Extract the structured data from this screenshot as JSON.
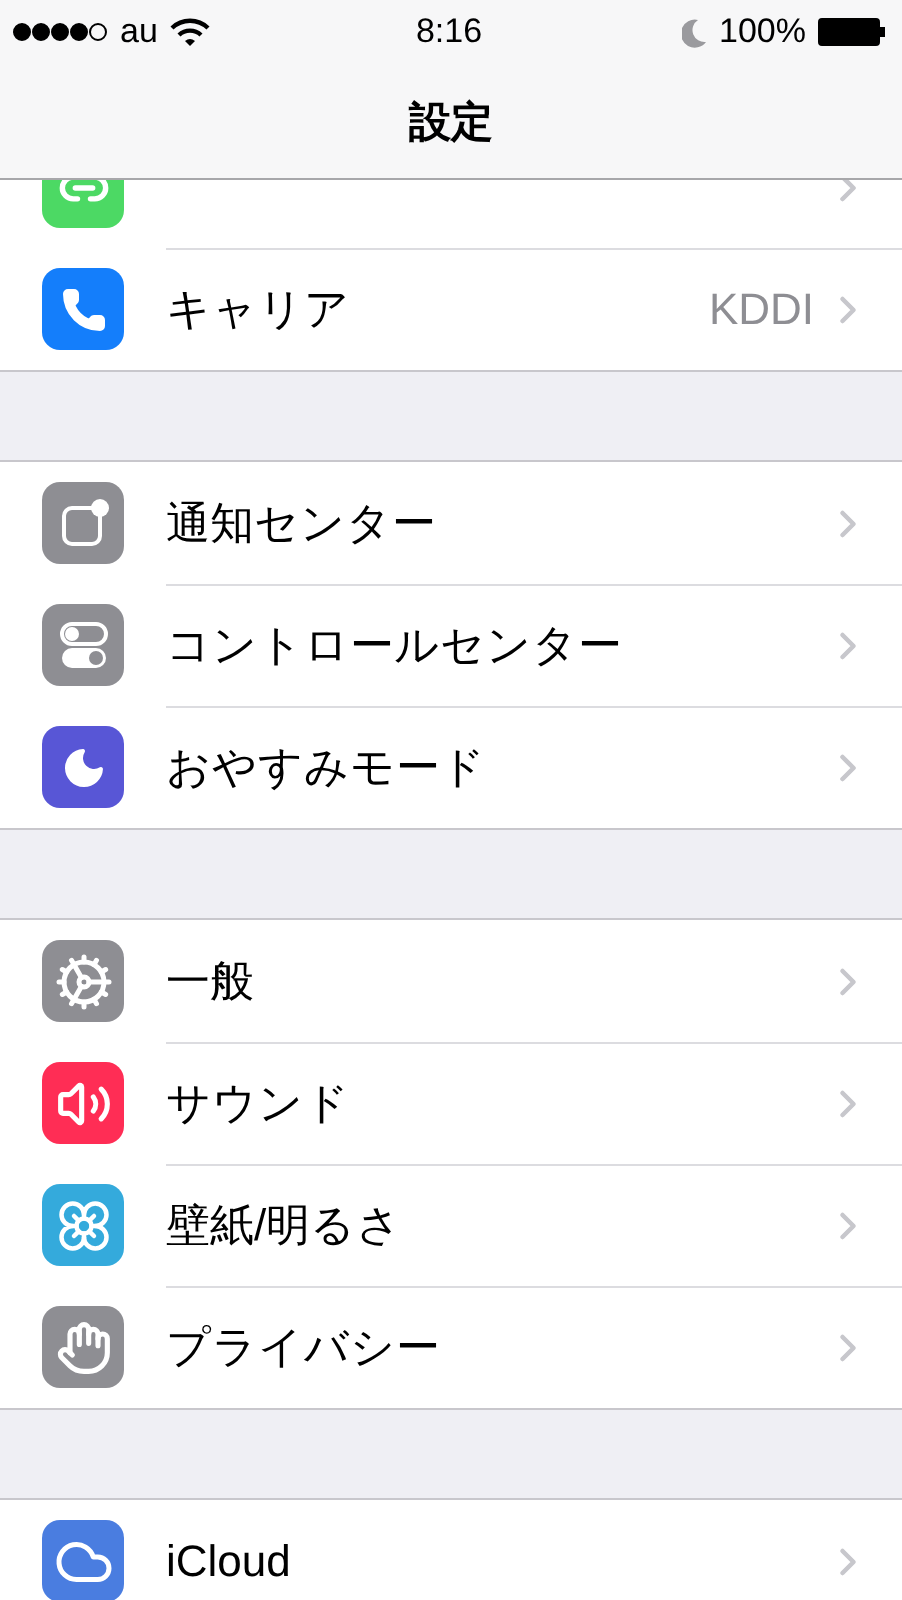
{
  "status_bar": {
    "carrier": "au",
    "time": "8:16",
    "do_not_disturb": true,
    "battery_percent": "100%"
  },
  "nav_bar": {
    "title": "設定"
  },
  "groups": [
    {
      "items": [
        {
          "kind": "hotspot",
          "color": "#4cd964"
        },
        {
          "label": "キャリア",
          "kind": "phone",
          "color": "#147efb",
          "detail": "KDDI"
        }
      ]
    },
    {
      "items": [
        {
          "label": "通知センター",
          "kind": "notifications",
          "color": "#8e8e93"
        },
        {
          "label": "コントロールセンター",
          "kind": "switches",
          "color": "#8e8e93"
        },
        {
          "label": "おやすみモード",
          "kind": "moon",
          "color": "#5856d6"
        }
      ]
    },
    {
      "items": [
        {
          "label": "一般",
          "kind": "gear",
          "color": "#8e8e93"
        },
        {
          "label": "サウンド",
          "kind": "speaker",
          "color": "#ff2d55"
        },
        {
          "label": "壁紙/明るさ",
          "kind": "flower",
          "color": "#34aadc"
        },
        {
          "label": "プライバシー",
          "kind": "hand",
          "color": "#8e8e93"
        }
      ]
    },
    {
      "items": [
        {
          "label": "iCloud",
          "kind": "cloud",
          "color": "#4a7de0"
        }
      ]
    }
  ]
}
